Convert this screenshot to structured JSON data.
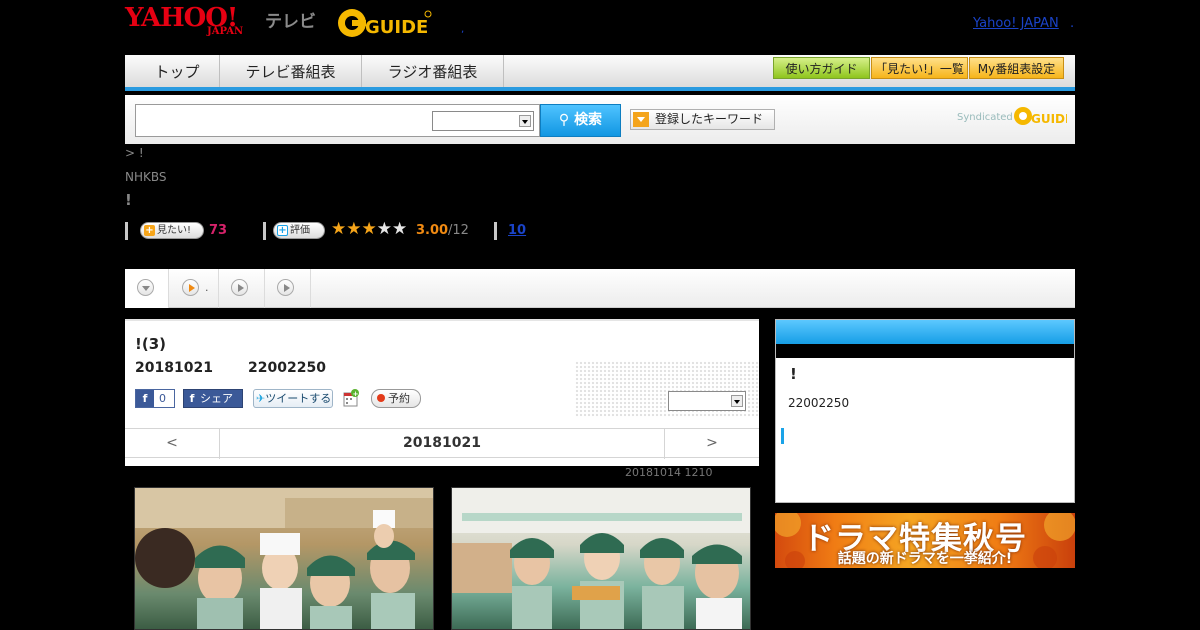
{
  "header": {
    "yahoo_logo": "YAHOO!",
    "yahoo_logo_sub": "JAPAN",
    "tv_logo": "テレビ",
    "gguide_logo": "G GUIDE",
    "yahoo_japan_link": "Yahoo! JAPAN",
    "header_dot": ",",
    "link_dot": "."
  },
  "nav": {
    "tabs": [
      "トップ",
      "テレビ番組表",
      "ラジオ番組表"
    ],
    "buttons": [
      "使い方ガイド",
      "「見たい!」一覧",
      "My番組表設定"
    ]
  },
  "search": {
    "button_label": "検索",
    "keyword_button": "登録したキーワード",
    "syndicated": "Syndicated"
  },
  "program": {
    "breadcrumb": "> !",
    "channel": "NHKBS",
    "title": "!",
    "mitai_label": "見たい!",
    "mitai_count": "73",
    "rating_label": "評価",
    "rating": 3.0,
    "rating_score": "3.00",
    "rating_count": "/12",
    "review_link": "10"
  },
  "tabs": {
    "tab2_label": "."
  },
  "episode": {
    "title": "!(3)",
    "date": "20181021",
    "time": "22002250",
    "fb_like_count": "0",
    "fb_share_label": "シェア",
    "tweet_label": "ツイートする",
    "reserve_label": "予約",
    "pager_prev": "<",
    "pager_date": "20181021",
    "pager_next": ">",
    "updated": "20181014  1210"
  },
  "sidebar": {
    "title": "!",
    "time": "22002250"
  },
  "banner": {
    "title": "ドラマ特集秋号",
    "subtitle": "話題の新ドラマを一挙紹介!"
  },
  "colors": {
    "accent_blue": "#2a9be0",
    "mitai_pink": "#d6226a",
    "score_orange": "#f08a12",
    "link_blue": "#1a43c8"
  }
}
